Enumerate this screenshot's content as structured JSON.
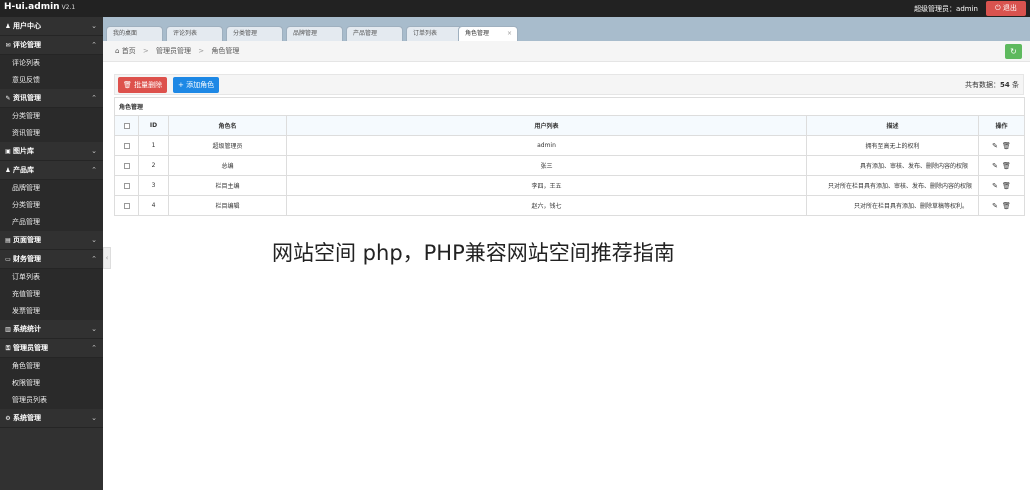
{
  "header": {
    "logo": "H-ui.admin",
    "version": "V2.1",
    "admin_label": "超级管理员：admin",
    "logout_label": "退出"
  },
  "sidebar": {
    "groups": [
      {
        "label": "用户中心",
        "icon": "user-icon",
        "glyph": "♟",
        "chevron": "⌄"
      },
      {
        "label": "评论管理",
        "icon": "comment-icon",
        "glyph": "✉",
        "chevron": "⌃",
        "items": [
          "评论列表",
          "意见反馈"
        ]
      },
      {
        "label": "资讯管理",
        "icon": "edit-icon",
        "glyph": "✎",
        "chevron": "⌃",
        "items": [
          "分类管理",
          "资讯管理"
        ]
      },
      {
        "label": "图片库",
        "icon": "picture-icon",
        "glyph": "▣",
        "chevron": "⌄"
      },
      {
        "label": "产品库",
        "icon": "product-icon",
        "glyph": "♟",
        "chevron": "⌃",
        "items": [
          "品牌管理",
          "分类管理",
          "产品管理"
        ]
      },
      {
        "label": "页面管理",
        "icon": "page-icon",
        "glyph": "▤",
        "chevron": "⌄"
      },
      {
        "label": "财务管理",
        "icon": "finance-icon",
        "glyph": "▭",
        "chevron": "⌃",
        "items": [
          "订单列表",
          "充值管理",
          "发票管理"
        ]
      },
      {
        "label": "系统统计",
        "icon": "chart-icon",
        "glyph": "▥",
        "chevron": "⌄"
      },
      {
        "label": "管理员管理",
        "icon": "key-icon",
        "glyph": "⚿",
        "chevron": "⌃",
        "items": [
          "角色管理",
          "权限管理",
          "管理员列表"
        ]
      },
      {
        "label": "系统管理",
        "icon": "gear-icon",
        "glyph": "⚙",
        "chevron": "⌄"
      }
    ],
    "collapse_glyph": "‹"
  },
  "tabs": [
    {
      "label": "我的桌面"
    },
    {
      "label": "评论列表"
    },
    {
      "label": "分类管理"
    },
    {
      "label": "品牌管理"
    },
    {
      "label": "产品管理"
    },
    {
      "label": "订单列表"
    },
    {
      "label": "角色管理",
      "active": true,
      "close": "×"
    }
  ],
  "breadcrumb": {
    "home_glyph": "⌂",
    "home": "首页",
    "sep": ">",
    "level1": "管理员管理",
    "level2": "角色管理",
    "refresh_glyph": "↻"
  },
  "toolbar": {
    "batch_delete": "批量删除",
    "add_role": "添加角色",
    "count_prefix": "共有数据：",
    "count_value": "54",
    "count_suffix": " 条"
  },
  "table": {
    "caption": "角色管理",
    "headers": [
      "ID",
      "角色名",
      "用户列表",
      "描述",
      "操作"
    ],
    "rows": [
      {
        "id": "1",
        "role": "超级管理员",
        "users": "admin",
        "desc": "拥有至高无上的权利"
      },
      {
        "id": "2",
        "role": "总编",
        "users": "张三",
        "desc": "具有添加、审核、发布、删除内容的权限"
      },
      {
        "id": "3",
        "role": "栏目主编",
        "users": "李四，王五",
        "desc": "只对所在栏目具有添加、审核、发布、删除内容的权限"
      },
      {
        "id": "4",
        "role": "栏目编辑",
        "users": "赵六，钱七",
        "desc": "只对所在栏目具有添加、删除草稿等权利。"
      }
    ],
    "edit_glyph": "✎",
    "delete_glyph": "🗑"
  },
  "overlay_text": "网站空间 php，PHP兼容网站空间推荐指南",
  "colors": {
    "topbar": "#222222",
    "sidebar": "#313131",
    "danger": "#dd514c",
    "primary": "#1e88e5",
    "success": "#5eb95e",
    "tabbar": "#a8bccc"
  }
}
